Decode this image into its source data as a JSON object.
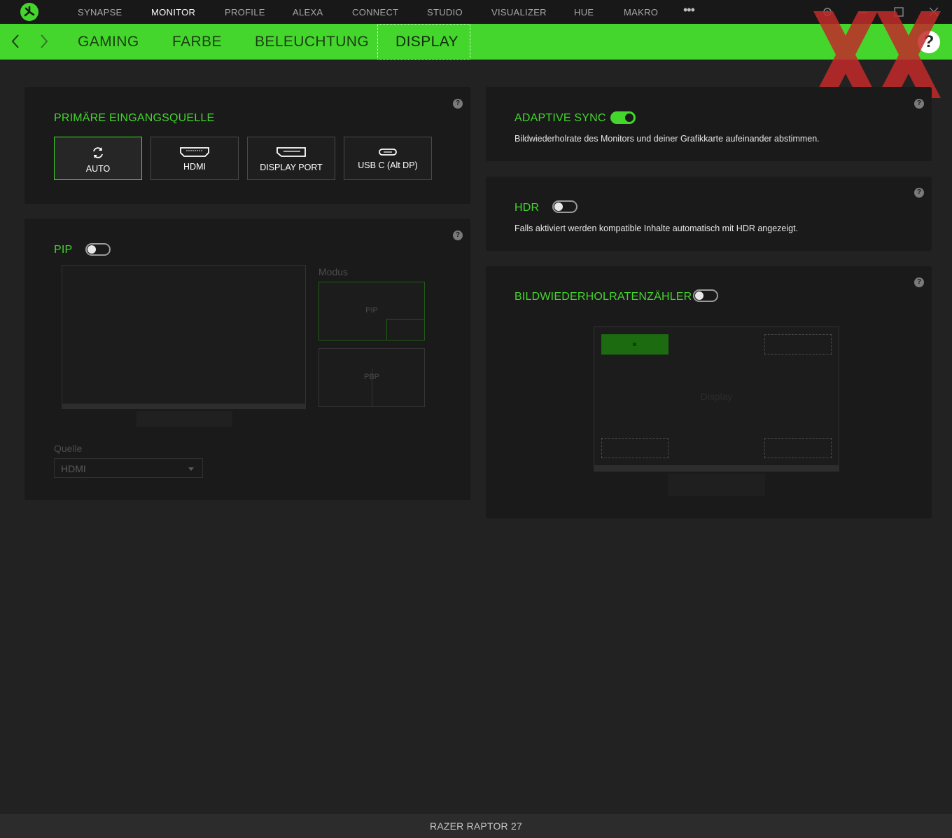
{
  "topnav": {
    "items": [
      "SYNAPSE",
      "MONITOR",
      "PROFILE",
      "ALEXA",
      "CONNECT",
      "STUDIO",
      "VISUALIZER",
      "HUE",
      "MAKRO"
    ],
    "active_index": 1,
    "more_label": "•••"
  },
  "subnav": {
    "tabs": [
      "GAMING",
      "FARBE",
      "BELEUCHTUNG",
      "DISPLAY"
    ],
    "active_index": 3,
    "help_label": "?"
  },
  "input_source": {
    "title": "PRIMÄRE EINGANGSQUELLE",
    "buttons": [
      "AUTO",
      "HDMI",
      "DISPLAY PORT",
      "USB C (Alt DP)"
    ],
    "selected_index": 0
  },
  "pip": {
    "title": "PIP",
    "enabled": false,
    "mode_label": "Modus",
    "modes": [
      "PIP",
      "PBP"
    ],
    "selected_mode": "PIP",
    "source_label": "Quelle",
    "source_value": "HDMI"
  },
  "adaptive_sync": {
    "title": "ADAPTIVE SYNC",
    "enabled": true,
    "description": "Bildwiederholrate des Monitors und deiner Grafikkarte aufeinander abstimmen."
  },
  "hdr": {
    "title": "HDR",
    "enabled": false,
    "description": "Falls aktiviert werden kompatible Inhalte automatisch mit HDR angezeigt."
  },
  "fps_counter": {
    "title": "BILDWIEDERHOLRATENZÄHLER",
    "enabled": false,
    "display_label": "Display",
    "active_corner": "top-left"
  },
  "status": {
    "device_name": "RAZER RAPTOR 27"
  },
  "help_marker": "?",
  "colors": {
    "accent": "#44d62c",
    "background": "#222222",
    "card": "#1a1a1a"
  }
}
